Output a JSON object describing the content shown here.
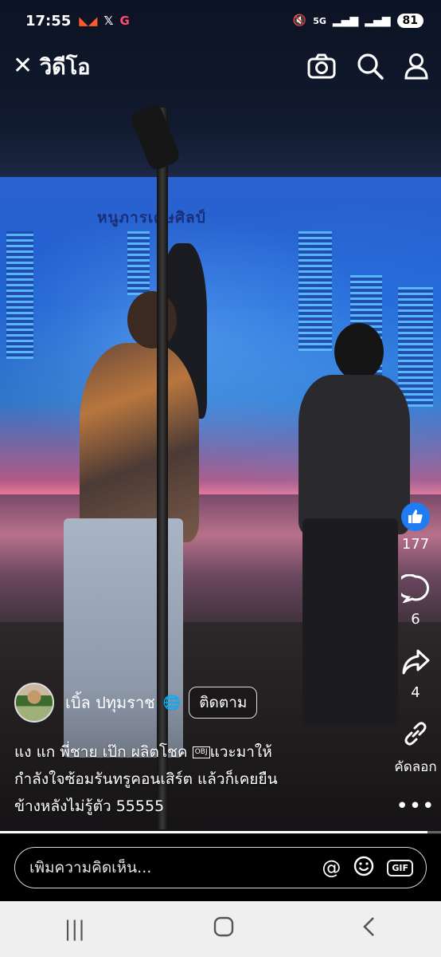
{
  "status_bar": {
    "time": "17:55",
    "app_icons": [
      "shopee-icon",
      "x-icon",
      "g-icon"
    ],
    "network": "5G",
    "battery": "81"
  },
  "header": {
    "title": "วิดีโอ",
    "close_icon": "close-icon",
    "actions": [
      "camera-icon",
      "search-icon",
      "profile-icon"
    ]
  },
  "video_overlay_text": "หนูภารเศษศิลป์",
  "actions_rail": {
    "like_count": "177",
    "comment_count": "6",
    "share_count": "4",
    "copy_link_label": "คัดลอก",
    "more_icon": "more-icon"
  },
  "author": {
    "name": "เบิ้ล ปทุมราช",
    "follow_label": "ติดตาม"
  },
  "caption": {
    "line1a": "แง แก พี่ชาย เป๊ก ผลิตโชค ",
    "obj": "OBJ",
    "line1b": "แวะมาให้",
    "line2": "กำลังใจซ้อมรันทรูคอนเสิร์ต แล้วก็เคยยืน",
    "line3": "ข้างหลังไม่รู้ตัว 55555"
  },
  "playback": {
    "progress_fraction": 0.97
  },
  "comment": {
    "placeholder": "เพิ่มความคิดเห็น..."
  },
  "colors": {
    "like_blue": "#1f7cf2",
    "background": "#000000",
    "navbar": "#efefef"
  }
}
